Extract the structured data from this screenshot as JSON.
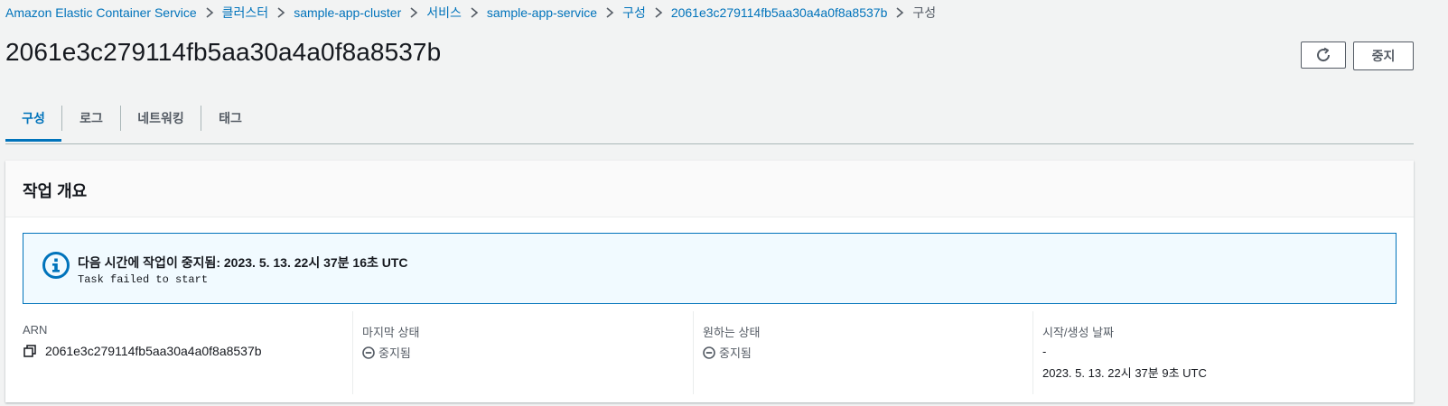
{
  "breadcrumb": {
    "items": [
      "Amazon Elastic Container Service",
      "클러스터",
      "sample-app-cluster",
      "서비스",
      "sample-app-service",
      "구성",
      "2061e3c279114fb5aa30a4a0f8a8537b"
    ],
    "current": "구성"
  },
  "page": {
    "title": "2061e3c279114fb5aa30a4a0f8a8537b",
    "refresh_icon": "refresh-icon",
    "stop_label": "중지"
  },
  "tabs": [
    {
      "label": "구성",
      "active": true
    },
    {
      "label": "로그",
      "active": false
    },
    {
      "label": "네트워킹",
      "active": false
    },
    {
      "label": "태그",
      "active": false
    }
  ],
  "overview": {
    "title": "작업 개요",
    "alert": {
      "icon": "info-icon",
      "title": "다음 시간에 작업이 중지됨: 2023. 5. 13. 22시 37분 16초 UTC",
      "message": "Task failed to start"
    },
    "arn": {
      "label": "ARN",
      "value": "2061e3c279114fb5aa30a4a0f8a8537b",
      "icon": "copy-icon"
    },
    "last_status": {
      "label": "마지막 상태",
      "value": "중지됨",
      "icon": "stopped-icon"
    },
    "desired_status": {
      "label": "원하는 상태",
      "value": "중지됨",
      "icon": "stopped-icon"
    },
    "start_time": {
      "label": "시작/생성 날짜",
      "value_line1": "-",
      "value_line2": "2023. 5. 13. 22시 37분 9초 UTC"
    }
  },
  "colors": {
    "link": "#0073bb",
    "text": "#16191f",
    "muted": "#545b64",
    "background": "#f2f3f3",
    "alert_bg": "#f1faff"
  }
}
